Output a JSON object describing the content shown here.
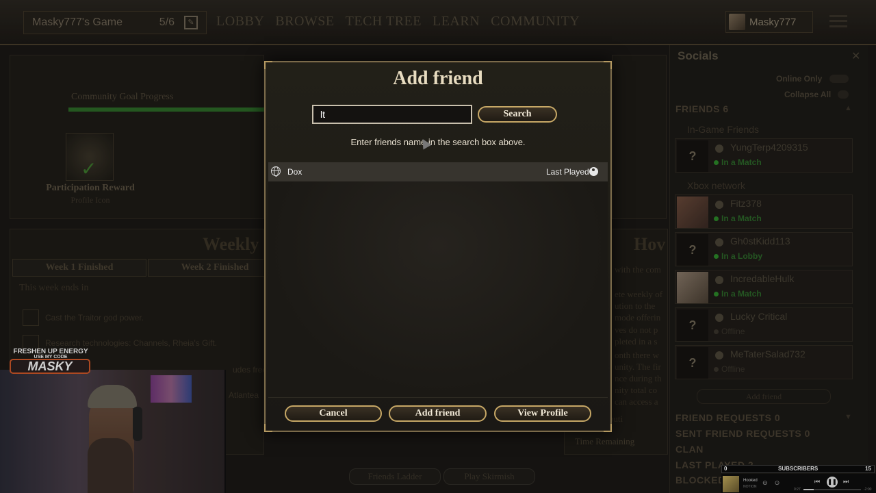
{
  "topbar": {
    "game_name": "Masky777's Game",
    "player_count": "5/6",
    "nav": [
      "LOBBY",
      "BROWSE",
      "TECH TREE",
      "LEARN",
      "COMMUNITY"
    ],
    "username": "Masky777"
  },
  "community": {
    "goal_label": "Community Goal Progress",
    "reward_title": "Participation Reward",
    "reward_subtitle": "Profile Icon"
  },
  "weekly": {
    "title": "Weekly",
    "tabs": [
      "Week 1 Finished",
      "Week 2 Finished"
    ],
    "ends_label": "This week ends in",
    "tasks": [
      "Cast the Traitor god power.",
      "Research technologies: Channels, Rheia's Gift.",
      "udes free",
      "Atlantea"
    ]
  },
  "how": {
    "title": "Hov",
    "lines": [
      "with the com",
      "ete weekly of",
      "ution to the",
      "mode offerin",
      "ves do not p",
      "pleted in a s",
      "onth there w",
      "unity. The fir",
      "nce during th",
      "nity total co",
      "can access a"
    ],
    "contribution": "al Contributi",
    "time_remaining": "Time Remaining"
  },
  "bottom_buttons": {
    "friends_ladder": "Friends Ladder",
    "play_skirmish": "Play Skirmish"
  },
  "socials": {
    "title": "Socials",
    "online_only": "Online Only",
    "collapse_all": "Collapse All",
    "friends_header": "FRIENDS 6",
    "in_game_header": "In-Game Friends",
    "xbox_header": "Xbox network",
    "friends": [
      {
        "name": "YungTerp4209315",
        "status": "In a Match",
        "avatar": "?"
      },
      {
        "name": "Fitz378",
        "status": "In a Match",
        "avatar": ""
      },
      {
        "name": "Gh0stKidd113",
        "status": "In a Lobby",
        "avatar": "?"
      },
      {
        "name": "IncredableHulk",
        "status": "In a Match",
        "avatar": ""
      },
      {
        "name": "Lucky Critical",
        "status": "Offline",
        "avatar": "?"
      },
      {
        "name": "MeTaterSalad732",
        "status": "Offline",
        "avatar": "?"
      }
    ],
    "add_friend": "Add friend",
    "friend_requests": "FRIEND REQUESTS 0",
    "sent_requests": "SENT FRIEND REQUESTS 0",
    "clan": "CLAN",
    "last_played": "LAST PLAYED 2",
    "blocked": "BLOCKED"
  },
  "stream": {
    "promo_line1": "FRESHEN UP ENERGY",
    "promo_line2": "USE MY CODE",
    "promo_code": "MASKY",
    "sub_left": "0",
    "sub_label": "SUBSCRIBERS",
    "sub_right": "15",
    "song_title": "Hooked",
    "song_artist": "NOTION",
    "time_start": "0:27",
    "time_end": "-2:00",
    "progress": 0.18
  },
  "modal": {
    "title": "Add friend",
    "search_value": "lt",
    "search_button": "Search",
    "hint": "Enter friends name in the search box above.",
    "list_name_header": "Dox",
    "list_last_played": "Last Played",
    "cancel": "Cancel",
    "add_friend": "Add friend",
    "view_profile": "View Profile"
  },
  "colors": {
    "gold_border": "#c7a866",
    "status_green": "#2d8a2a",
    "panel_bg": "#1a1815"
  }
}
